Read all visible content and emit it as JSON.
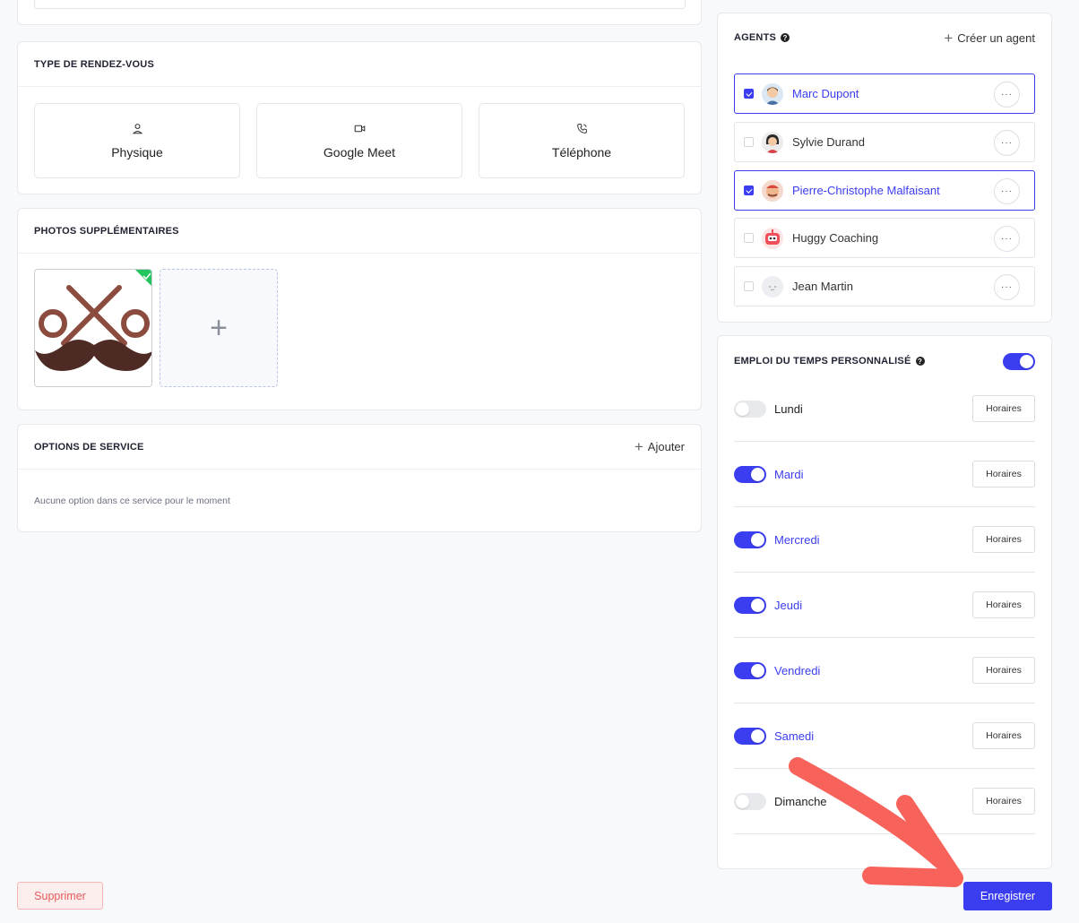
{
  "appointment_type": {
    "title": "TYPE DE RENDEZ-VOUS",
    "options": [
      {
        "label": "Physique",
        "icon": "person-icon"
      },
      {
        "label": "Google Meet",
        "icon": "video-icon"
      },
      {
        "label": "Téléphone",
        "icon": "phone-icon"
      }
    ]
  },
  "photos": {
    "title": "PHOTOS SUPPLÉMENTAIRES",
    "add_icon": "+"
  },
  "service_options": {
    "title": "OPTIONS DE SERVICE",
    "add_label": "Ajouter",
    "empty_text": "Aucune option dans ce service pour le moment"
  },
  "agents": {
    "title": "AGENTS",
    "create_label": "Créer un agent",
    "items": [
      {
        "name": "Marc Dupont",
        "selected": true
      },
      {
        "name": "Sylvie Durand",
        "selected": false
      },
      {
        "name": "Pierre-Christophe Malfaisant",
        "selected": true
      },
      {
        "name": "Huggy Coaching",
        "selected": false
      },
      {
        "name": "Jean Martin",
        "selected": false
      }
    ],
    "more_label": "···"
  },
  "schedule": {
    "title": "EMPLOI DU TEMPS PERSONNALISÉ",
    "enabled": true,
    "hours_label": "Horaires",
    "days": [
      {
        "label": "Lundi",
        "on": false
      },
      {
        "label": "Mardi",
        "on": true
      },
      {
        "label": "Mercredi",
        "on": true
      },
      {
        "label": "Jeudi",
        "on": true
      },
      {
        "label": "Vendredi",
        "on": true
      },
      {
        "label": "Samedi",
        "on": true
      },
      {
        "label": "Dimanche",
        "on": false
      }
    ]
  },
  "footer": {
    "delete_label": "Supprimer",
    "save_label": "Enregistrer"
  },
  "colors": {
    "accent": "#3b3df0",
    "danger": "#e65a5a",
    "annotation_arrow": "#f7635a",
    "success": "#22c55e"
  }
}
